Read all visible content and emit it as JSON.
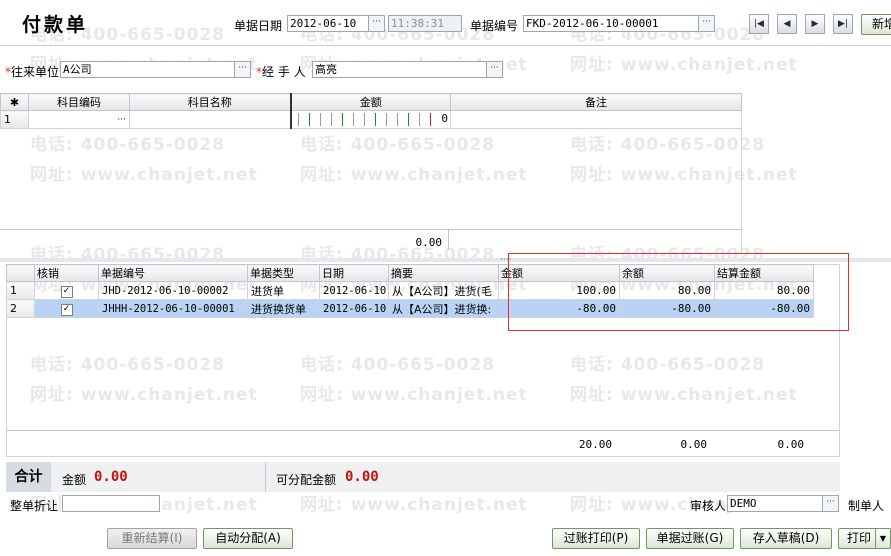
{
  "header": {
    "title": "付款单",
    "date_label": "单据日期",
    "date_value": "2012-06-10",
    "time_value": "11:38:31",
    "docno_label": "单据编号",
    "docno_value": "FKD-2012-06-10-00001",
    "new_button": "新增"
  },
  "form": {
    "partner_label": "往来单位",
    "partner_value": "A公司",
    "handler_label": "经 手 人",
    "handler_value": "高亮"
  },
  "top_grid": {
    "headers": [
      "科目编码",
      "科目名称",
      "金额",
      "备注"
    ],
    "rows": [
      {
        "num": "1",
        "amount": "0"
      }
    ],
    "total": "0.00"
  },
  "bottom_grid": {
    "headers": [
      "核销",
      "单据编号",
      "单据类型",
      "日期",
      "摘要",
      "金额",
      "余额",
      "结算金额"
    ],
    "rows": [
      {
        "num": "1",
        "doc": "JHD-2012-06-10-00002",
        "type": "进货单",
        "date": "2012-06-10",
        "summary": "从【A公司】进货(毛",
        "amount": "100.00",
        "balance": "80.00",
        "settle": "80.00"
      },
      {
        "num": "2",
        "doc": "JHHH-2012-06-10-00001",
        "type": "进货换货单",
        "date": "2012-06-10",
        "summary": "从【A公司】进货换:",
        "amount": "-80.00",
        "balance": "-80.00",
        "settle": "-80.00"
      }
    ],
    "totals": {
      "amount": "20.00",
      "balance": "0.00",
      "settle": "0.00"
    }
  },
  "summary": {
    "total_label": "合计",
    "amount_label": "金额",
    "amount_value": "0.00",
    "alloc_label": "可分配金额",
    "alloc_value": "0.00"
  },
  "footer": {
    "discount_label": "整单折让",
    "discount_value": "",
    "reviewer_label": "审核人",
    "reviewer_value": "DEMO",
    "maker_label": "制单人"
  },
  "buttons": {
    "recalc": "重新结算(I)",
    "auto_alloc": "自动分配(A)",
    "post_print": "过账打印(P)",
    "post": "单据过账(G)",
    "save_draft": "存入草稿(D)",
    "print": "打印"
  },
  "watermark": {
    "phone": "电话: 400-665-0028",
    "site": "网址: www.chanjet.net"
  },
  "colors": {
    "highlight_box": "#e0302a",
    "amount_red": "#c0140c",
    "selected_row": "#b8d3f5"
  }
}
